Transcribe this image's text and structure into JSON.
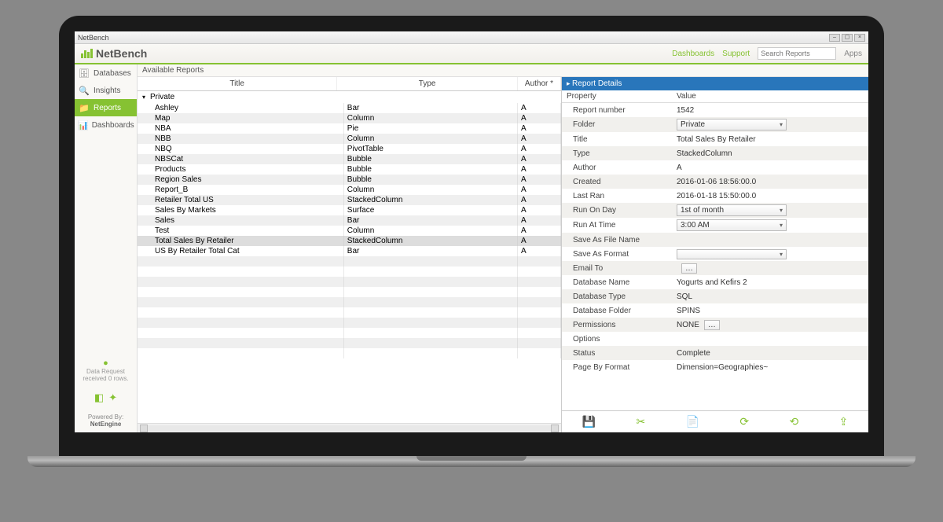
{
  "window": {
    "title": "NetBench",
    "search_placeholder": "Search Reports",
    "apps": "Apps"
  },
  "logo_text": "NetBench",
  "header_links": {
    "dashboards": "Dashboards",
    "support": "Support"
  },
  "sidebar": {
    "items": [
      {
        "label": "Databases",
        "icon": "db"
      },
      {
        "label": "Insights",
        "icon": "insights"
      },
      {
        "label": "Reports",
        "icon": "reports"
      },
      {
        "label": "Dashboards",
        "icon": "dash"
      }
    ],
    "status_line1": "Data Request",
    "status_line2": "received 0 rows.",
    "powered_label": "Powered By:",
    "powered_name": "NetEngine"
  },
  "available_reports_label": "Available Reports",
  "columns": {
    "title": "Title",
    "type": "Type",
    "author": "Author *"
  },
  "group_label": "Private",
  "reports": [
    {
      "title": "Ashley",
      "type": "Bar",
      "author": "A"
    },
    {
      "title": "Map",
      "type": "Column",
      "author": "A"
    },
    {
      "title": "NBA",
      "type": "Pie",
      "author": "A"
    },
    {
      "title": "NBB",
      "type": "Column",
      "author": "A"
    },
    {
      "title": "NBQ",
      "type": "PivotTable",
      "author": "A"
    },
    {
      "title": "NBSCat",
      "type": "Bubble",
      "author": "A"
    },
    {
      "title": "Products",
      "type": "Bubble",
      "author": "A"
    },
    {
      "title": "Region Sales",
      "type": "Bubble",
      "author": "A"
    },
    {
      "title": "Report_B",
      "type": "Column",
      "author": "A"
    },
    {
      "title": "Retailer Total US",
      "type": "StackedColumn",
      "author": "A"
    },
    {
      "title": "Sales By Markets",
      "type": "Surface",
      "author": "A"
    },
    {
      "title": "Sales",
      "type": "Bar",
      "author": "A"
    },
    {
      "title": "Test",
      "type": "Column",
      "author": "A"
    },
    {
      "title": "Total Sales By Retailer",
      "type": "StackedColumn",
      "author": "A",
      "selected": true
    },
    {
      "title": "US By Retailer Total Cat",
      "type": "Bar",
      "author": "A"
    }
  ],
  "details": {
    "header": "Report Details",
    "property_col": "Property",
    "value_col": "Value",
    "rows": [
      {
        "label": "Report number",
        "value": "1542",
        "kind": "text"
      },
      {
        "label": "Folder",
        "value": "Private",
        "kind": "select"
      },
      {
        "label": "Title",
        "value": "Total Sales By Retailer",
        "kind": "text"
      },
      {
        "label": "Type",
        "value": "StackedColumn",
        "kind": "text"
      },
      {
        "label": "Author",
        "value": "A",
        "kind": "text"
      },
      {
        "label": "Created",
        "value": "2016-01-06 18:56:00.0",
        "kind": "text"
      },
      {
        "label": "Last Ran",
        "value": "2016-01-18 15:50:00.0",
        "kind": "text"
      },
      {
        "label": "Run On Day",
        "value": "1st of month",
        "kind": "select"
      },
      {
        "label": "Run At Time",
        "value": "3:00 AM",
        "kind": "select"
      },
      {
        "label": "Save As File Name",
        "value": "",
        "kind": "text"
      },
      {
        "label": "Save As Format",
        "value": "",
        "kind": "select"
      },
      {
        "label": "Email To",
        "value": "",
        "kind": "button"
      },
      {
        "label": "Database Name",
        "value": "Yogurts and Kefirs 2",
        "kind": "text"
      },
      {
        "label": "Database Type",
        "value": "SQL",
        "kind": "text"
      },
      {
        "label": "Database Folder",
        "value": "SPINS",
        "kind": "text"
      },
      {
        "label": "Permissions",
        "value": "NONE",
        "kind": "button"
      },
      {
        "label": "Options",
        "value": "",
        "kind": "text"
      },
      {
        "label": "Status",
        "value": "Complete",
        "kind": "text"
      },
      {
        "label": "Page By Format",
        "value": "Dimension=Geographies~",
        "kind": "text"
      }
    ]
  }
}
